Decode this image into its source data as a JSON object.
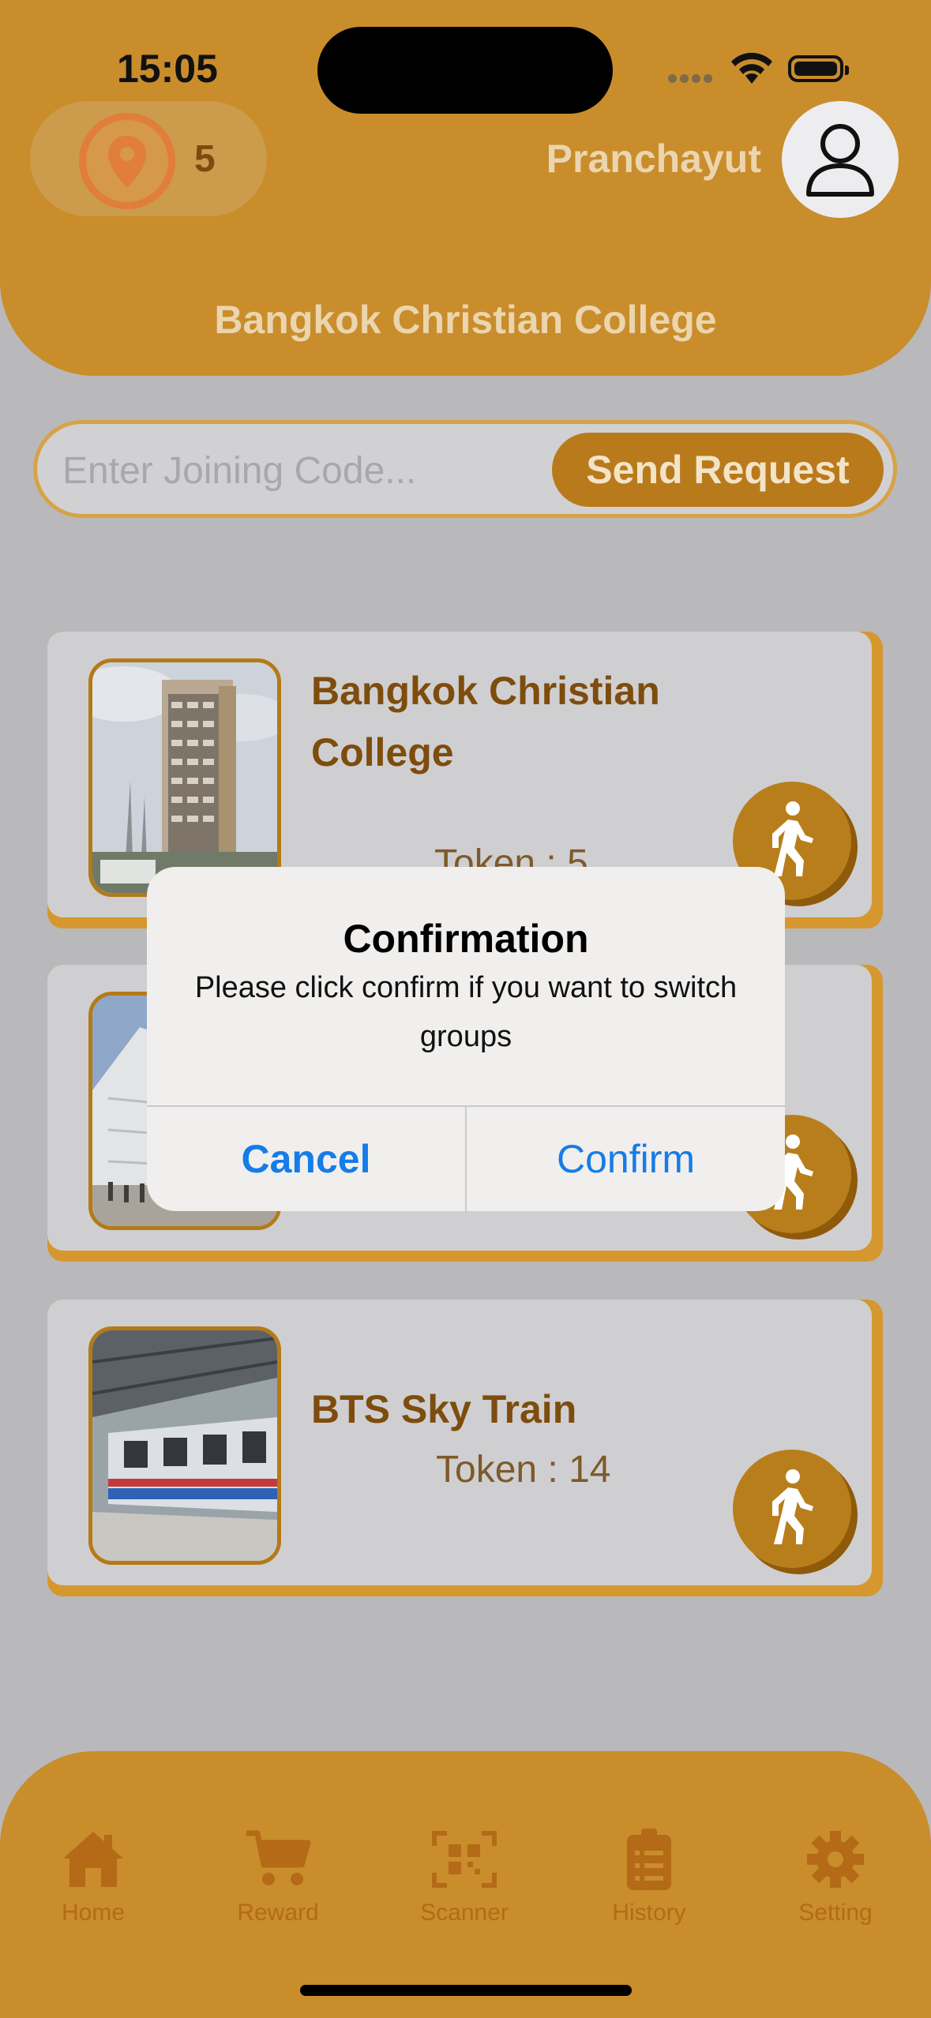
{
  "status_bar": {
    "time": "15:05"
  },
  "header": {
    "token_count": "5",
    "username": "Pranchayut",
    "group_title": "Bangkok Christian College"
  },
  "join": {
    "placeholder": "Enter Joining Code...",
    "button_label": "Send Request"
  },
  "cards": [
    {
      "title": "Bangkok Christian College",
      "token": "Token : 5",
      "image": "building-photo"
    },
    {
      "title": "",
      "token": "",
      "image": "mall-photo"
    },
    {
      "title": "BTS Sky Train",
      "token": "Token : 14",
      "image": "train-photo"
    }
  ],
  "dialog": {
    "title": "Confirmation",
    "message": "Please click confirm if you want to switch groups",
    "cancel_label": "Cancel",
    "confirm_label": "Confirm"
  },
  "tabs": [
    {
      "label": "Home",
      "icon": "home-icon"
    },
    {
      "label": "Reward",
      "icon": "cart-icon"
    },
    {
      "label": "Scanner",
      "icon": "qr-scanner-icon"
    },
    {
      "label": "History",
      "icon": "clipboard-icon"
    },
    {
      "label": "Setting",
      "icon": "gear-icon"
    }
  ],
  "colors": {
    "primary": "#c98d2c",
    "dark_accent": "#b97a1c",
    "dialog_button": "#157ce8",
    "background": "#b9b9bb"
  }
}
